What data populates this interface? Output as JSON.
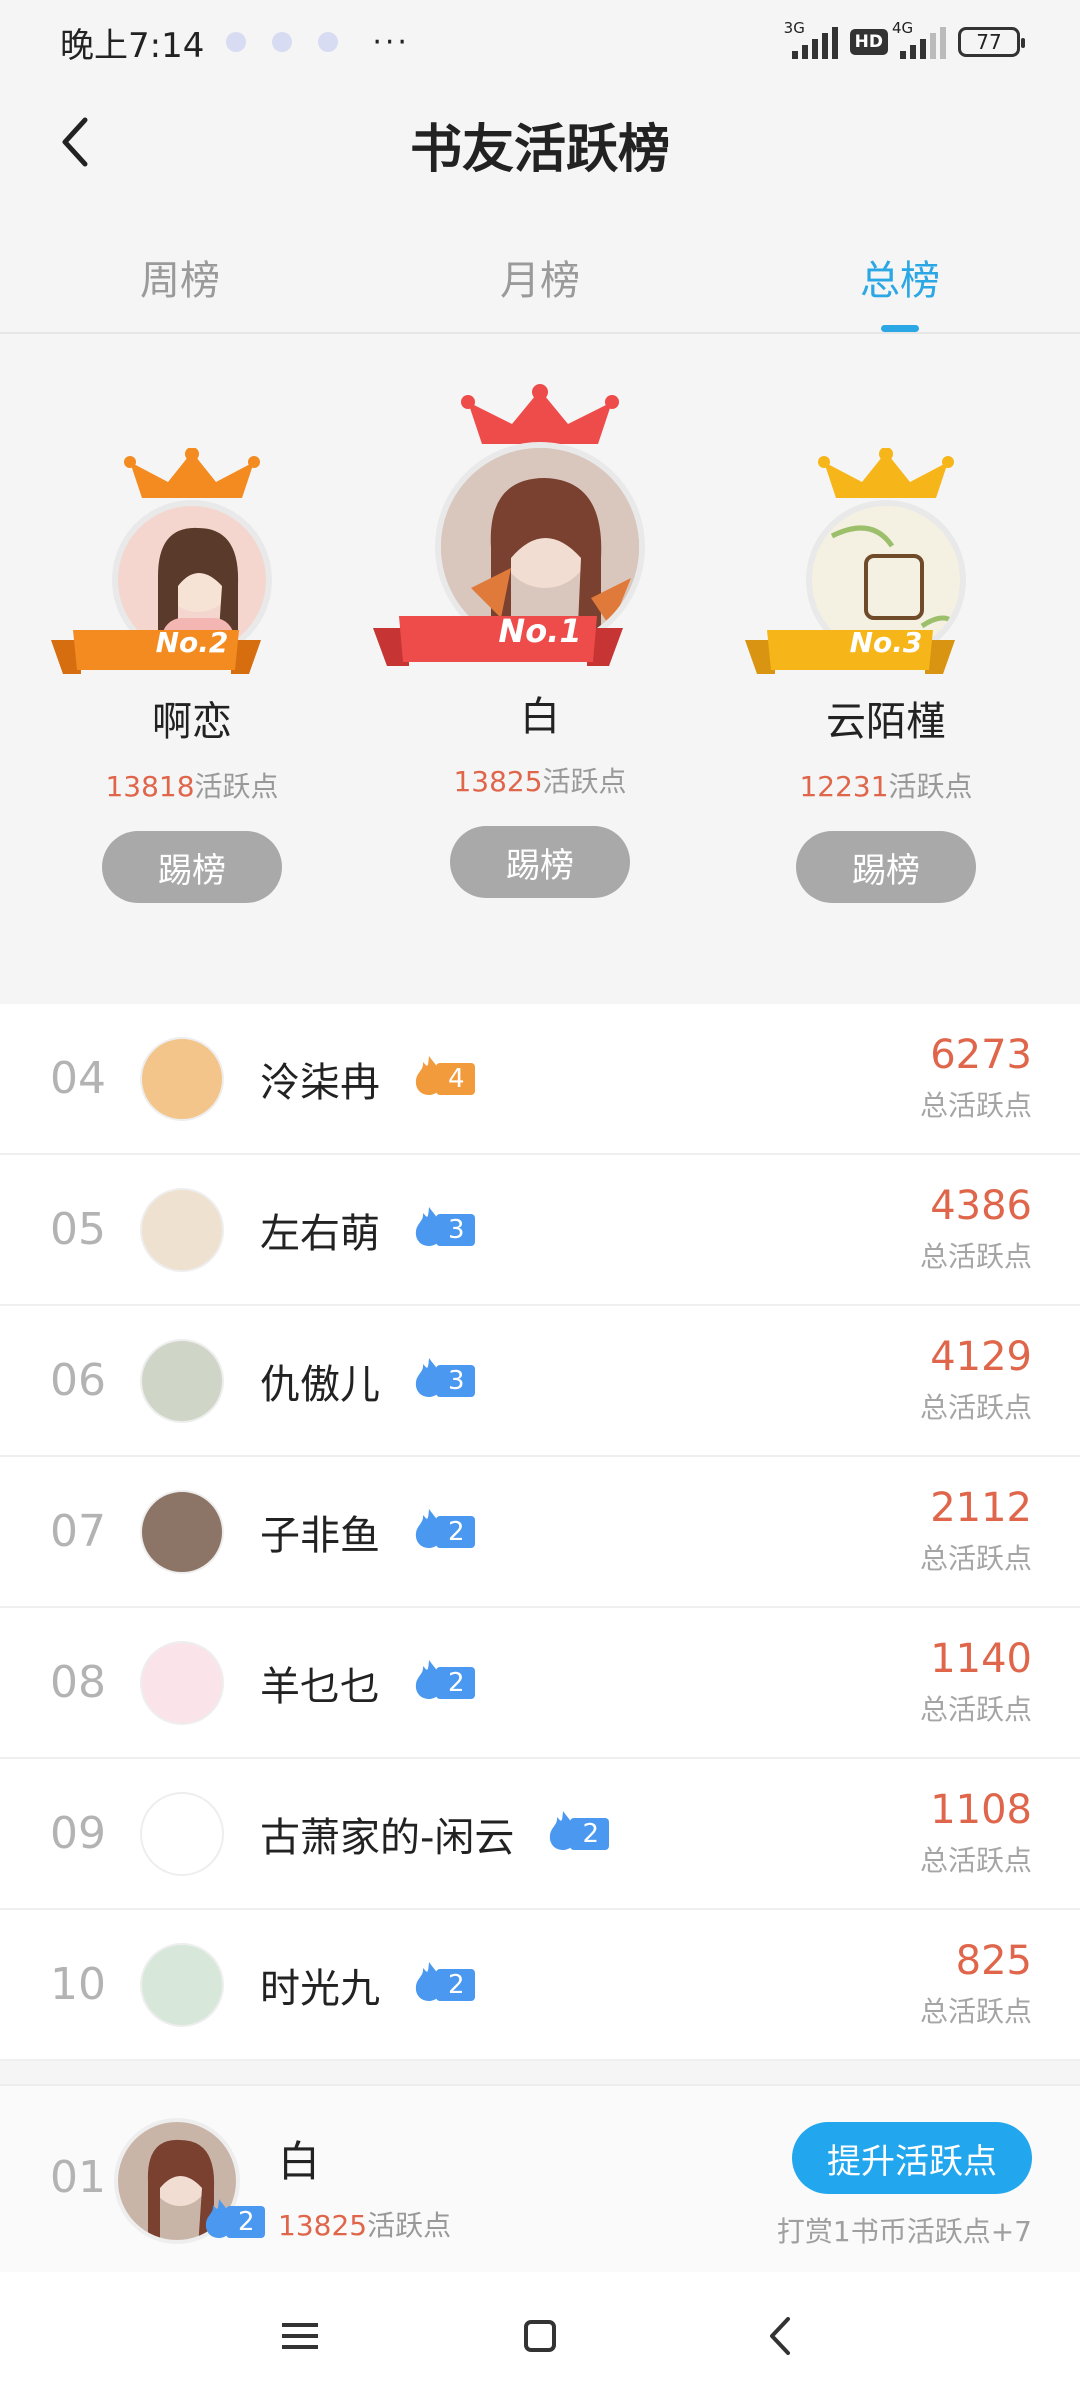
{
  "status_bar": {
    "time": "晚上7:14",
    "more": "···",
    "signal1_label": "3G",
    "hd_label": "HD",
    "signal2_label": "4G",
    "battery": "77"
  },
  "header": {
    "title": "书友活跃榜"
  },
  "tabs": [
    {
      "label": "周榜",
      "active": false
    },
    {
      "label": "月榜",
      "active": false
    },
    {
      "label": "总榜",
      "active": true
    }
  ],
  "podium": [
    {
      "rank_label": "No.1",
      "name": "白",
      "points": "13825",
      "points_suffix": "活跃点",
      "button": "踢榜",
      "color": "#ee4b4b"
    },
    {
      "rank_label": "No.2",
      "name": "啊恋",
      "points": "13818",
      "points_suffix": "活跃点",
      "button": "踢榜",
      "color": "#f38b20"
    },
    {
      "rank_label": "No.3",
      "name": "云陌槿",
      "points": "12231",
      "points_suffix": "活跃点",
      "button": "踢榜",
      "color": "#f6b61a"
    }
  ],
  "ranking": [
    {
      "rank": "04",
      "name": "泠柒冉",
      "level": "4",
      "score": "6273",
      "score_label": "总活跃点",
      "level_color": "orange"
    },
    {
      "rank": "05",
      "name": "左右萌",
      "level": "3",
      "score": "4386",
      "score_label": "总活跃点",
      "level_color": "blue"
    },
    {
      "rank": "06",
      "name": "仇傲儿",
      "level": "3",
      "score": "4129",
      "score_label": "总活跃点",
      "level_color": "blue"
    },
    {
      "rank": "07",
      "name": "子非鱼",
      "level": "2",
      "score": "2112",
      "score_label": "总活跃点",
      "level_color": "blue"
    },
    {
      "rank": "08",
      "name": "羊乜乜",
      "level": "2",
      "score": "1140",
      "score_label": "总活跃点",
      "level_color": "blue"
    },
    {
      "rank": "09",
      "name": "古萧家的-闲云",
      "level": "2",
      "score": "1108",
      "score_label": "总活跃点",
      "level_color": "blue"
    },
    {
      "rank": "10",
      "name": "时光九",
      "level": "2",
      "score": "825",
      "score_label": "总活跃点",
      "level_color": "blue"
    }
  ],
  "my_rank": {
    "rank": "01",
    "name": "白",
    "level": "2",
    "points": "13825",
    "points_suffix": "活跃点",
    "boost_button": "提升活跃点",
    "tip": "打赏1书币活跃点+7"
  },
  "colors": {
    "accent": "#2aa7e4",
    "score": "#e0664b",
    "boost": "#22a7ee"
  },
  "icons": {
    "back": "back-arrow-icon",
    "flame": "flame-icon",
    "crown": "crown-icon",
    "nav_menu": "menu-icon",
    "nav_home": "home-square-icon",
    "nav_back": "back-triangle-icon"
  }
}
